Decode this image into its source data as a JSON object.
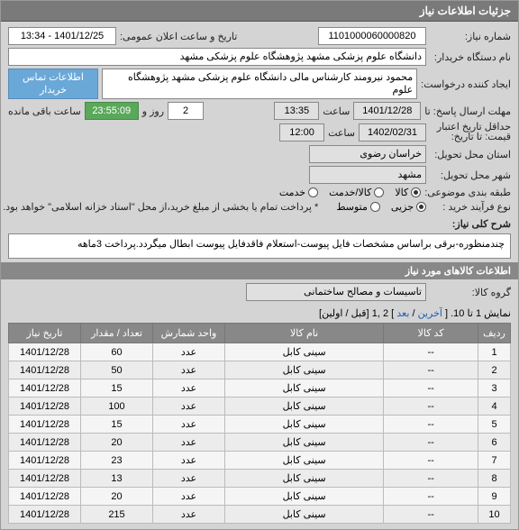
{
  "header": {
    "title": "جزئیات اطلاعات نیاز"
  },
  "form": {
    "need_no_label": "شماره نیاز:",
    "need_no": "1101000060000820",
    "announce_label": "تاریخ و ساعت اعلان عمومی:",
    "announce_value": "1401/12/25 - 13:34",
    "buyer_label": "نام دستگاه خریدار:",
    "buyer_value": "دانشگاه علوم پزشکی مشهد   پژوهشگاه علوم پزشکی مشهد",
    "requester_label": "ایجاد کننده درخواست:",
    "requester_value": "محمود نیرومند کارشناس مالی دانشگاه علوم پزشکی مشهد   پژوهشگاه علوم",
    "contact_label": "اطلاعات تماس خریدار",
    "deadline_label": "مهلت ارسال پاسخ: تا",
    "deadline_date": "1401/12/28",
    "time_label1": "ساعت",
    "deadline_time": "13:35",
    "days_value": "2",
    "days_label": "روز و",
    "remaining_time": "23:55:09",
    "remaining_label": "ساعت باقی مانده",
    "credit_label": "حداقل تاریخ اعتبار",
    "credit_label2": "قیمت: تا تاریخ:",
    "credit_date": "1402/02/31",
    "time_label2": "ساعت",
    "credit_time": "12:00",
    "province_label": "استان محل تحویل:",
    "province_value": "خراسان رضوی",
    "city_label": "شهر محل تحویل:",
    "city_value": "مشهد",
    "category_label": "طبقه بندی موضوعی:",
    "cat_goods": "کالا",
    "cat_service": "کالا/خدمت",
    "cat_other": "خدمت",
    "process_label": "نوع فرآیند خرید :",
    "process_partial": "جزیی",
    "process_medium": "متوسط",
    "process_note": "* پرداخت تمام یا بخشی از مبلغ خرید،از محل \"اسناد خزانه اسلامی\" خواهد بود.",
    "desc_section_label": "شرح کلی نیاز:",
    "desc_value": "چندمنظوره-برقی براساس مشخصات فایل پیوست-استعلام فاقدفایل پیوست ابطال میگردد.پرداخت 3ماهه",
    "items_section": "اطلاعات کالاهای مورد نیاز",
    "group_label": "گروه کالا:",
    "group_value": "تاسیسات و مصالح ساختمانی",
    "pager_text1": "نمایش 1 تا 10. [ ",
    "pager_last": "آخرین",
    "pager_sep1": " / ",
    "pager_next": "بعد",
    "pager_text2": " ] 2 ,1 [قبل / اولین]"
  },
  "table": {
    "headers": {
      "row": "ردیف",
      "code": "کد کالا",
      "name": "نام کالا",
      "unit": "واحد شمارش",
      "qty": "تعداد / مقدار",
      "date": "تاریخ نیاز"
    },
    "rows": [
      {
        "n": "1",
        "code": "--",
        "name": "سینی کابل",
        "unit": "عدد",
        "qty": "60",
        "date": "1401/12/28"
      },
      {
        "n": "2",
        "code": "--",
        "name": "سینی کابل",
        "unit": "عدد",
        "qty": "50",
        "date": "1401/12/28"
      },
      {
        "n": "3",
        "code": "--",
        "name": "سینی کابل",
        "unit": "عدد",
        "qty": "15",
        "date": "1401/12/28"
      },
      {
        "n": "4",
        "code": "--",
        "name": "سینی کابل",
        "unit": "عدد",
        "qty": "100",
        "date": "1401/12/28"
      },
      {
        "n": "5",
        "code": "--",
        "name": "سینی کابل",
        "unit": "عدد",
        "qty": "15",
        "date": "1401/12/28"
      },
      {
        "n": "6",
        "code": "--",
        "name": "سینی کابل",
        "unit": "عدد",
        "qty": "20",
        "date": "1401/12/28"
      },
      {
        "n": "7",
        "code": "--",
        "name": "سینی کابل",
        "unit": "عدد",
        "qty": "23",
        "date": "1401/12/28"
      },
      {
        "n": "8",
        "code": "--",
        "name": "سینی کابل",
        "unit": "عدد",
        "qty": "13",
        "date": "1401/12/28"
      },
      {
        "n": "9",
        "code": "--",
        "name": "سینی کابل",
        "unit": "عدد",
        "qty": "20",
        "date": "1401/12/28"
      },
      {
        "n": "10",
        "code": "--",
        "name": "سینی کابل",
        "unit": "عدد",
        "qty": "215",
        "date": "1401/12/28"
      }
    ]
  }
}
